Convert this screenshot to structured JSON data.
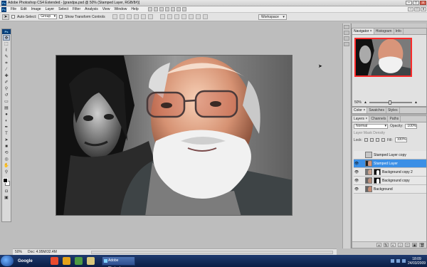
{
  "titlebar": {
    "app_icon": "Ps",
    "title": "Adobe Photoshop CS4 Extended - [grandpa.psd @ 50% (Stamped Layer, RGB/8#)]",
    "buttons": [
      "–",
      "□",
      "x"
    ]
  },
  "menubar": {
    "items": [
      "File",
      "Edit",
      "Image",
      "Layer",
      "Select",
      "Filter",
      "Analysis",
      "View",
      "Window",
      "Help"
    ],
    "restore_buttons": [
      "–",
      "□",
      "x"
    ]
  },
  "options": {
    "auto_select_label": "Auto-Select:",
    "auto_select_value": "Group",
    "show_transform_label": "Show Transform Controls",
    "workspace_label": "Workspace"
  },
  "toolbox": {
    "tools": [
      "move-icon",
      "marquee-icon",
      "lasso-icon",
      "quick-select-icon",
      "crop-icon",
      "eyedropper-icon",
      "healing-icon",
      "brush-icon",
      "clone-stamp-icon",
      "history-brush-icon",
      "eraser-icon",
      "gradient-icon",
      "blur-icon",
      "dodge-icon",
      "pen-icon",
      "type-icon",
      "path-select-icon",
      "shape-icon",
      "3d-rotate-icon",
      "3d-camera-icon",
      "hand-icon",
      "zoom-icon"
    ]
  },
  "status": {
    "zoom": "50%",
    "doc": "Doc: 4.95M/32.4M"
  },
  "panels": {
    "navigator": {
      "tabs": [
        "Navigator ×",
        "Histogram",
        "Info"
      ],
      "zoom": "50%"
    },
    "color": {
      "tabs": [
        "Color ×",
        "Swatches",
        "Styles"
      ]
    },
    "layers": {
      "tabs": [
        "Layers ×",
        "Channels",
        "Paths"
      ],
      "blend_mode": "Normal",
      "opacity_label": "Opacity:",
      "opacity": "100%",
      "lock_label": "Lock:",
      "fill_label": "Fill:",
      "fill": "100%",
      "mask_density": "Layer Mask Density",
      "items": [
        {
          "name": "Stamped Layer copy",
          "visible": false,
          "mask": false,
          "active": false,
          "empty": true
        },
        {
          "name": "Stamped Layer",
          "visible": true,
          "mask": false,
          "active": true,
          "empty": false
        },
        {
          "name": "Background copy 2",
          "visible": true,
          "mask": true,
          "active": false,
          "empty": false
        },
        {
          "name": "Background copy",
          "visible": true,
          "mask": true,
          "active": false,
          "empty": false
        },
        {
          "name": "Background",
          "visible": true,
          "mask": false,
          "active": false,
          "empty": false
        }
      ],
      "footer_icons": [
        "fx",
        "◐",
        "○",
        "□",
        "▣",
        "🗑"
      ]
    }
  },
  "taskbar": {
    "google": "Google",
    "task_label": "Adobe Photosho...",
    "time": "18:09",
    "date": "24/03/2009"
  },
  "colors": {
    "active_layer": "#3b8fe6",
    "nav_box": "#ff2a2a",
    "taskbar": "#1f3b6f"
  }
}
